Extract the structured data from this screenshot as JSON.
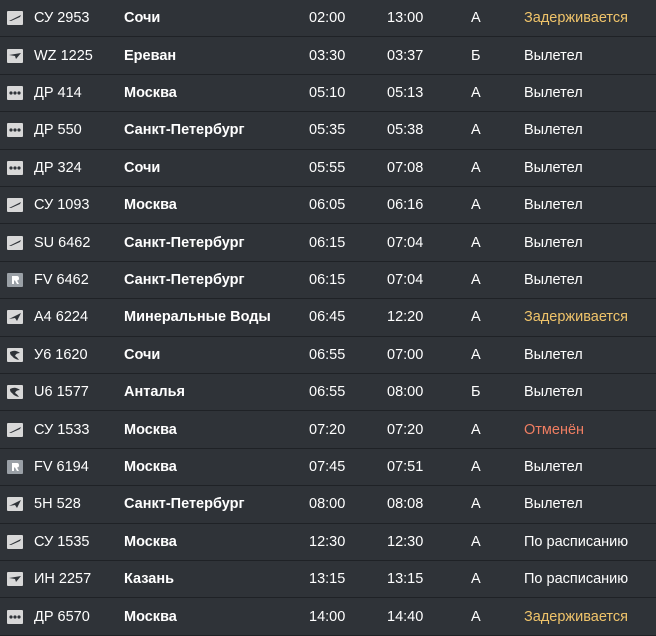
{
  "flights": [
    {
      "logo": "plane-swoosh-icon",
      "flight": "СУ 2953",
      "destination": "Сочи",
      "scheduled": "02:00",
      "actual": "13:00",
      "terminal": "A",
      "status": "Задерживается",
      "status_type": "delayed"
    },
    {
      "logo": "plane-tilted-icon",
      "flight": "WZ 1225",
      "destination": "Ереван",
      "scheduled": "03:30",
      "actual": "03:37",
      "terminal": "Б",
      "status": "Вылетел",
      "status_type": "normal"
    },
    {
      "logo": "dots-icon",
      "flight": "ДР 414",
      "destination": "Москва",
      "scheduled": "05:10",
      "actual": "05:13",
      "terminal": "A",
      "status": "Вылетел",
      "status_type": "normal"
    },
    {
      "logo": "dots-icon",
      "flight": "ДР 550",
      "destination": "Санкт-Петербург",
      "scheduled": "05:35",
      "actual": "05:38",
      "terminal": "A",
      "status": "Вылетел",
      "status_type": "normal"
    },
    {
      "logo": "dots-icon",
      "flight": "ДР 324",
      "destination": "Сочи",
      "scheduled": "05:55",
      "actual": "07:08",
      "terminal": "A",
      "status": "Вылетел",
      "status_type": "normal"
    },
    {
      "logo": "plane-swoosh-icon",
      "flight": "СУ 1093",
      "destination": "Москва",
      "scheduled": "06:05",
      "actual": "06:16",
      "terminal": "A",
      "status": "Вылетел",
      "status_type": "normal"
    },
    {
      "logo": "plane-swoosh-icon",
      "flight": "SU 6462",
      "destination": "Санкт-Петербург",
      "scheduled": "06:15",
      "actual": "07:04",
      "terminal": "A",
      "status": "Вылетел",
      "status_type": "normal"
    },
    {
      "logo": "r-box-icon",
      "flight": "FV 6462",
      "destination": "Санкт-Петербург",
      "scheduled": "06:15",
      "actual": "07:04",
      "terminal": "A",
      "status": "Вылетел",
      "status_type": "normal"
    },
    {
      "logo": "plane-diagonal-icon",
      "flight": "A4 6224",
      "destination": "Минеральные Воды",
      "scheduled": "06:45",
      "actual": "12:20",
      "terminal": "A",
      "status": "Задерживается",
      "status_type": "delayed"
    },
    {
      "logo": "bird-icon",
      "flight": "У6 1620",
      "destination": "Сочи",
      "scheduled": "06:55",
      "actual": "07:00",
      "terminal": "A",
      "status": "Вылетел",
      "status_type": "normal"
    },
    {
      "logo": "bird-icon",
      "flight": "U6 1577",
      "destination": "Анталья",
      "scheduled": "06:55",
      "actual": "08:00",
      "terminal": "Б",
      "status": "Вылетел",
      "status_type": "normal"
    },
    {
      "logo": "plane-swoosh-icon",
      "flight": "СУ 1533",
      "destination": "Москва",
      "scheduled": "07:20",
      "actual": "07:20",
      "terminal": "A",
      "status": "Отменён",
      "status_type": "cancelled"
    },
    {
      "logo": "r-box-icon",
      "flight": "FV 6194",
      "destination": "Москва",
      "scheduled": "07:45",
      "actual": "07:51",
      "terminal": "A",
      "status": "Вылетел",
      "status_type": "normal"
    },
    {
      "logo": "plane-diagonal-icon",
      "flight": "5H 528",
      "destination": "Санкт-Петербург",
      "scheduled": "08:00",
      "actual": "08:08",
      "terminal": "A",
      "status": "Вылетел",
      "status_type": "normal"
    },
    {
      "logo": "plane-swoosh-icon",
      "flight": "СУ 1535",
      "destination": "Москва",
      "scheduled": "12:30",
      "actual": "12:30",
      "terminal": "A",
      "status": "По расписанию",
      "status_type": "normal"
    },
    {
      "logo": "plane-tilted-icon",
      "flight": "ИН 2257",
      "destination": "Казань",
      "scheduled": "13:15",
      "actual": "13:15",
      "terminal": "A",
      "status": "По расписанию",
      "status_type": "normal"
    },
    {
      "logo": "dots-icon",
      "flight": "ДР 6570",
      "destination": "Москва",
      "scheduled": "14:00",
      "actual": "14:40",
      "terminal": "A",
      "status": "Задерживается",
      "status_type": "delayed"
    }
  ],
  "colors": {
    "background": "#2f3338",
    "row_divider": "#1f2226",
    "text": "#ffffff",
    "delayed": "#f0c46a",
    "cancelled": "#ef7e62",
    "logo_bg": "#d8d8d8",
    "logo_fg": "#2f3338"
  }
}
